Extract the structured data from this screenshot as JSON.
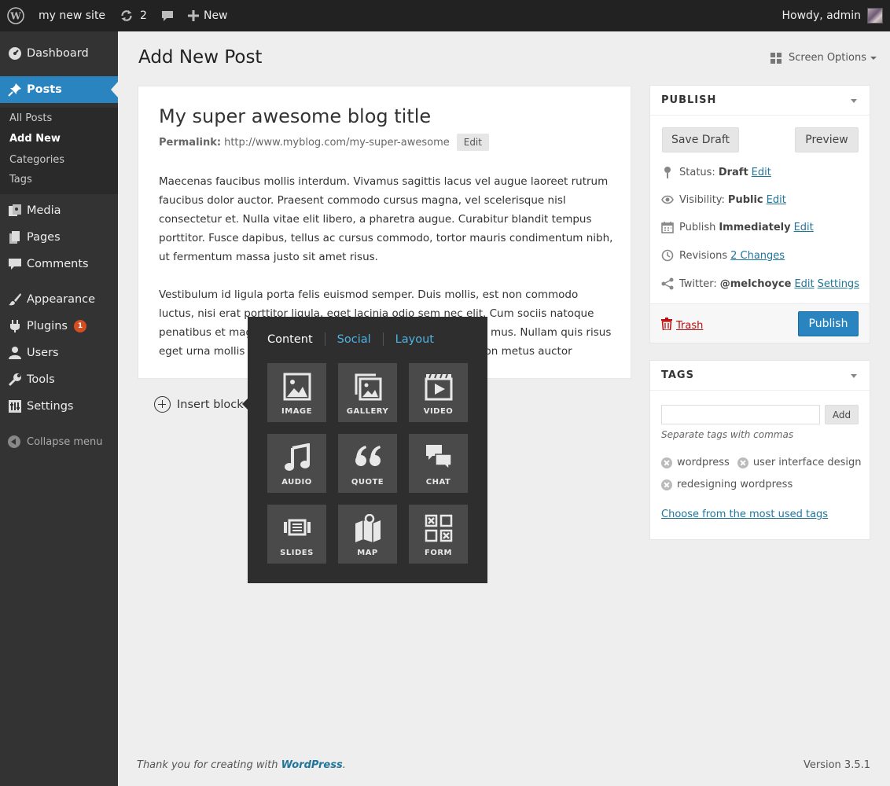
{
  "adminbar": {
    "site_name": "my new site",
    "updates_count": "2",
    "new_label": "New",
    "howdy": "Howdy, admin"
  },
  "sidebar": {
    "items": [
      {
        "label": "Dashboard",
        "icon": "dashboard-icon"
      },
      {
        "label": "Posts",
        "icon": "pushpin-icon"
      },
      {
        "label": "Media",
        "icon": "media-icon"
      },
      {
        "label": "Pages",
        "icon": "pages-icon"
      },
      {
        "label": "Comments",
        "icon": "comment-icon"
      },
      {
        "label": "Appearance",
        "icon": "brush-icon"
      },
      {
        "label": "Plugins",
        "icon": "plug-icon",
        "badge": "1"
      },
      {
        "label": "Users",
        "icon": "user-icon"
      },
      {
        "label": "Tools",
        "icon": "wrench-icon"
      },
      {
        "label": "Settings",
        "icon": "settings-icon"
      }
    ],
    "submenu": [
      "All Posts",
      "Add New",
      "Categories",
      "Tags"
    ],
    "collapse": "Collapse menu"
  },
  "header": {
    "title": "Add New Post",
    "screen_options": "Screen Options"
  },
  "editor": {
    "post_title": "My super awesome blog title",
    "permalink_label": "Permalink:",
    "permalink_url": "http://www.myblog.com/my-super-awesome",
    "edit_label": "Edit",
    "paragraph1": "Maecenas faucibus mollis interdum. Vivamus sagittis lacus vel augue laoreet rutrum faucibus dolor auctor. Praesent commodo cursus magna, vel scelerisque nisl consectetur et. Nulla vitae elit libero, a pharetra augue. Curabitur blandit tempus porttitor. Fusce dapibus, tellus ac cursus commodo, tortor mauris condimentum nibh, ut fermentum massa justo sit amet risus.",
    "paragraph2": "Vestibulum id ligula porta felis euismod semper. Duis mollis, est non commodo luctus, nisi erat porttitor ligula, eget lacinia odio sem nec elit. Cum sociis natoque penatibus et magnis dis parturient montes, nascetur ridiculus mus. Nullam quis risus eget urna mollis ornare vel eu leo. Donec ullamcorper nulla non metus auctor fringilla. Maecenas sed diam eget risus varius blandit sit amet non magna. Vestibulum id ligula porta felis euismod semper. Aenean lacinia bibendum nulla sed consectetur.",
    "insert_block": "Insert block"
  },
  "popover": {
    "tabs": [
      "Content",
      "Social",
      "Layout"
    ],
    "blocks": [
      {
        "label": "IMAGE",
        "icon": "image-icon"
      },
      {
        "label": "GALLERY",
        "icon": "gallery-icon"
      },
      {
        "label": "VIDEO",
        "icon": "video-icon"
      },
      {
        "label": "AUDIO",
        "icon": "music-note-icon"
      },
      {
        "label": "QUOTE",
        "icon": "quote-icon"
      },
      {
        "label": "CHAT",
        "icon": "chat-icon"
      },
      {
        "label": "SLIDES",
        "icon": "slides-icon"
      },
      {
        "label": "MAP",
        "icon": "map-icon"
      },
      {
        "label": "FORM",
        "icon": "form-icon"
      }
    ]
  },
  "publish": {
    "heading": "PUBLISH",
    "save_draft": "Save Draft",
    "preview": "Preview",
    "status_label": "Status:",
    "status_value": "Draft",
    "visibility_label": "Visibility:",
    "visibility_value": "Public",
    "publish_label": "Publish",
    "publish_value": "Immediately",
    "revisions_label": "Revisions",
    "revisions_link": "2 Changes",
    "twitter_label": "Twitter:",
    "twitter_value": "@melchoyce",
    "settings_link": "Settings",
    "edit_link": "Edit",
    "trash": "Trash",
    "publish_button": "Publish"
  },
  "tags": {
    "heading": "TAGS",
    "add_button": "Add",
    "hint": "Separate tags with commas",
    "items": [
      "wordpress",
      "user interface design",
      "redesigning wordpress"
    ],
    "choose_link": "Choose from the most used tags"
  },
  "footer": {
    "thanks": "Thank you for creating with",
    "wordpress": "WordPress",
    "version": "Version 3.5.1"
  }
}
